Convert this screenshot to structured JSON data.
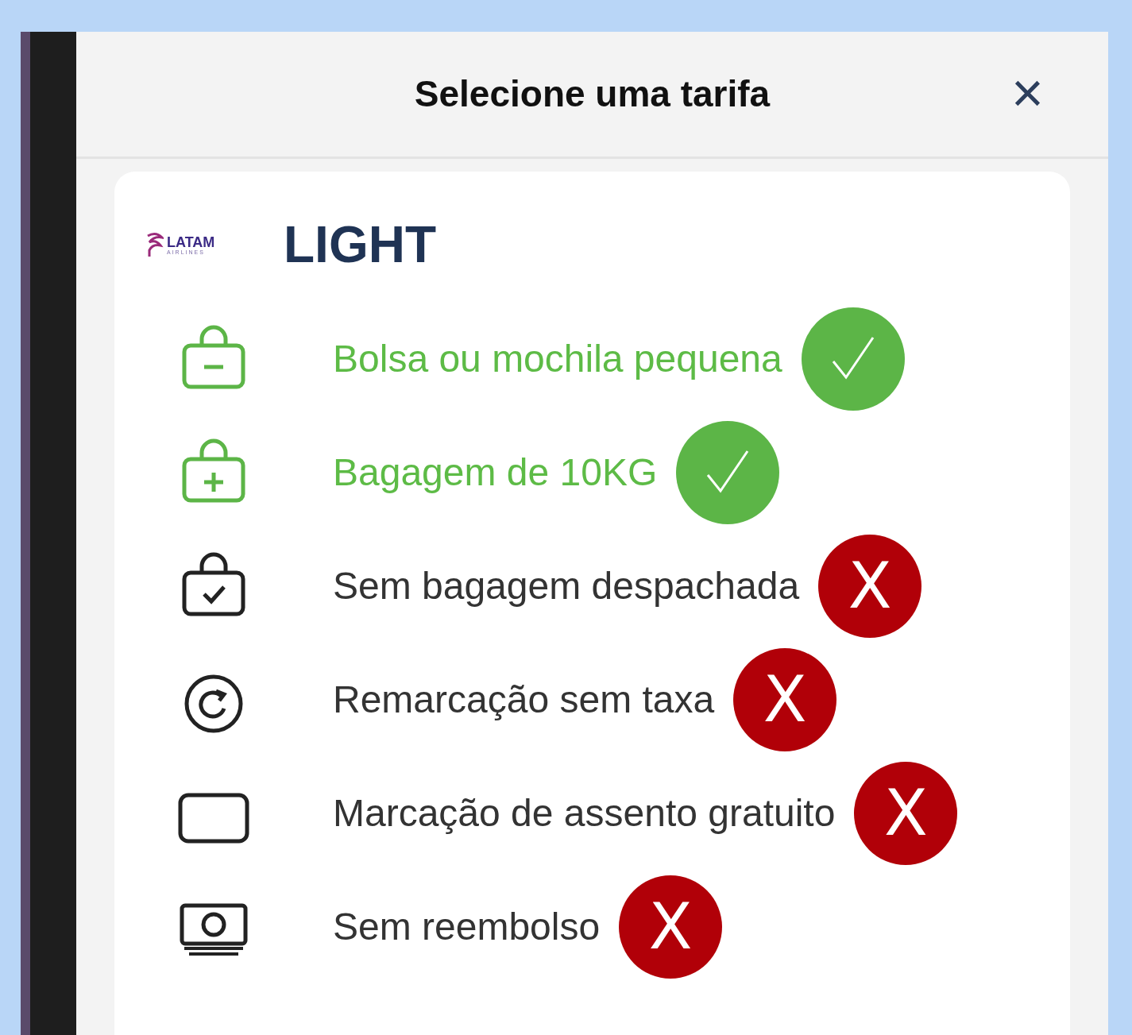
{
  "modal": {
    "title": "Selecione uma tarifa",
    "close": "×"
  },
  "fare": {
    "airline_logo": {
      "name": "LATAM",
      "subtitle": "AIRLINES"
    },
    "name": "LIGHT",
    "features": [
      {
        "kind": "bag-minus",
        "label": "Bolsa ou mochila pequena",
        "included": true
      },
      {
        "kind": "bag-plus",
        "label": "Bagagem de 10KG",
        "included": true
      },
      {
        "kind": "bag-check",
        "label": "Sem bagagem despachada",
        "included": false,
        "mark": "X"
      },
      {
        "kind": "rebook",
        "label": "Remarcação sem taxa",
        "included": false,
        "mark": "X"
      },
      {
        "kind": "seat",
        "label": "Marcação de assento gratuito",
        "included": false,
        "mark": "X"
      },
      {
        "kind": "money",
        "label": "Sem reembolso",
        "included": false,
        "mark": "X"
      }
    ]
  }
}
